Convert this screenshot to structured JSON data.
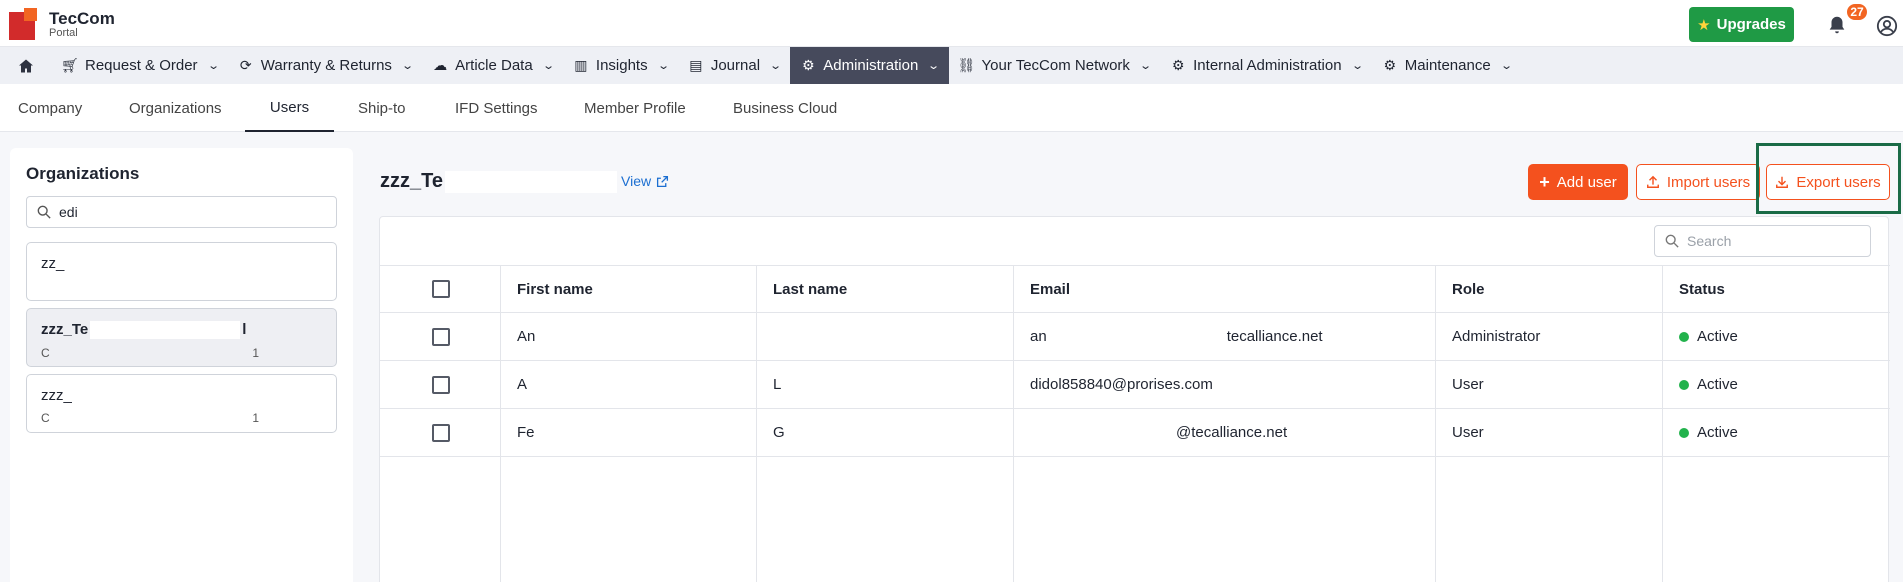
{
  "header": {
    "logo_title": "TecCom",
    "logo_subtitle": "Portal",
    "upgrades_label": "Upgrades",
    "notification_count": "27",
    "brand_color": "#d22b2b",
    "accent_color": "#f26522",
    "upgrade_color": "#1f9a45"
  },
  "main_nav": {
    "items": [
      {
        "label": "Request & Order",
        "icon": "cart-icon"
      },
      {
        "label": "Warranty & Returns",
        "icon": "returns-icon"
      },
      {
        "label": "Article Data",
        "icon": "cloud-icon"
      },
      {
        "label": "Insights",
        "icon": "bar-chart-icon"
      },
      {
        "label": "Journal",
        "icon": "table-icon"
      },
      {
        "label": "Administration",
        "icon": "gear-icon",
        "active": true
      },
      {
        "label": "Your TecCom Network",
        "icon": "link-icon"
      },
      {
        "label": "Internal Administration",
        "icon": "cogs-icon"
      },
      {
        "label": "Maintenance",
        "icon": "cogs-icon"
      }
    ]
  },
  "sub_nav": {
    "tabs": [
      "Company",
      "Organizations",
      "Users",
      "Ship-to",
      "IFD Settings",
      "Member Profile",
      "Business Cloud"
    ],
    "active": "Users"
  },
  "left_panel": {
    "title": "Organizations",
    "search_value": "edi",
    "orgs": [
      {
        "name": "zz_",
        "sub_left": "",
        "sub_right": ""
      },
      {
        "name": "zzz_Te",
        "name_tail": "l",
        "sub_left": "C",
        "sub_right": "1",
        "selected": true
      },
      {
        "name": "zzz_",
        "sub_left": "C",
        "sub_right": "1"
      }
    ]
  },
  "content": {
    "title": "zzz_Te",
    "view_label": "View",
    "add_user_label": "Add user",
    "import_users_label": "Import users",
    "export_users_label": "Export users",
    "search_placeholder": "Search",
    "columns": [
      "First name",
      "Last name",
      "Email",
      "Role",
      "Status"
    ],
    "rows": [
      {
        "first": "An",
        "last": "",
        "email_prefix": "an",
        "email_suffix": "tecalliance.net",
        "role": "Administrator",
        "status": "Active"
      },
      {
        "first": "A",
        "last": "L",
        "email_prefix": "didol858840@prorises.com",
        "email_suffix": "",
        "role": "User",
        "status": "Active"
      },
      {
        "first": "Fe",
        "last": "G",
        "email_prefix": "",
        "email_suffix": "@tecalliance.net",
        "role": "User",
        "status": "Active"
      }
    ]
  }
}
